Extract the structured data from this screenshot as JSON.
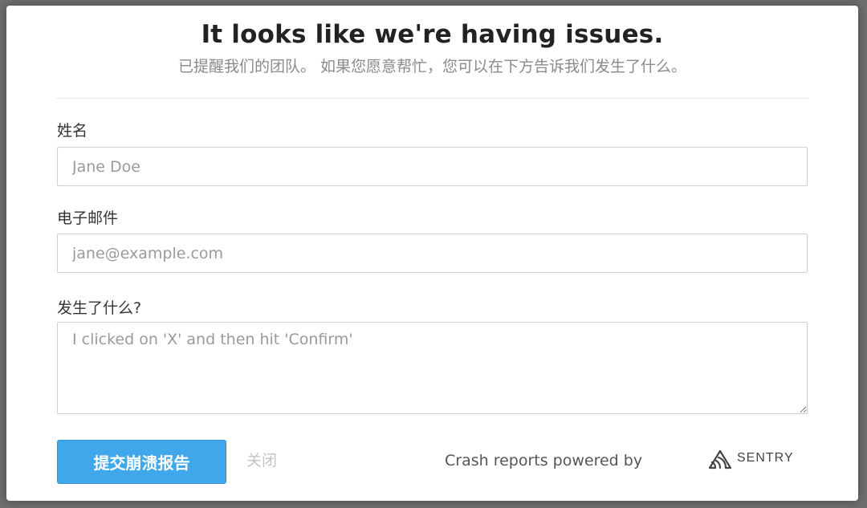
{
  "dialog": {
    "title": "It looks like we're having issues.",
    "subtitle": "已提醒我们的团队。 如果您愿意帮忙，您可以在下方告诉我们发生了什么。"
  },
  "form": {
    "name_label": "姓名",
    "name_placeholder": "Jane Doe",
    "email_label": "电子邮件",
    "email_placeholder": "jane@example.com",
    "comments_label": "发生了什么?",
    "comments_placeholder": "I clicked on 'X' and then hit 'Confirm'"
  },
  "actions": {
    "submit_label": "提交崩溃报告",
    "close_label": "关闭"
  },
  "footer": {
    "powered_text": "Crash reports powered by",
    "brand_logo_icon": "sentry-logo-icon",
    "brand_name": "SENTRY"
  },
  "colors": {
    "submit_bg": "#3fa7ea",
    "backdrop": "#6e6e6e"
  }
}
